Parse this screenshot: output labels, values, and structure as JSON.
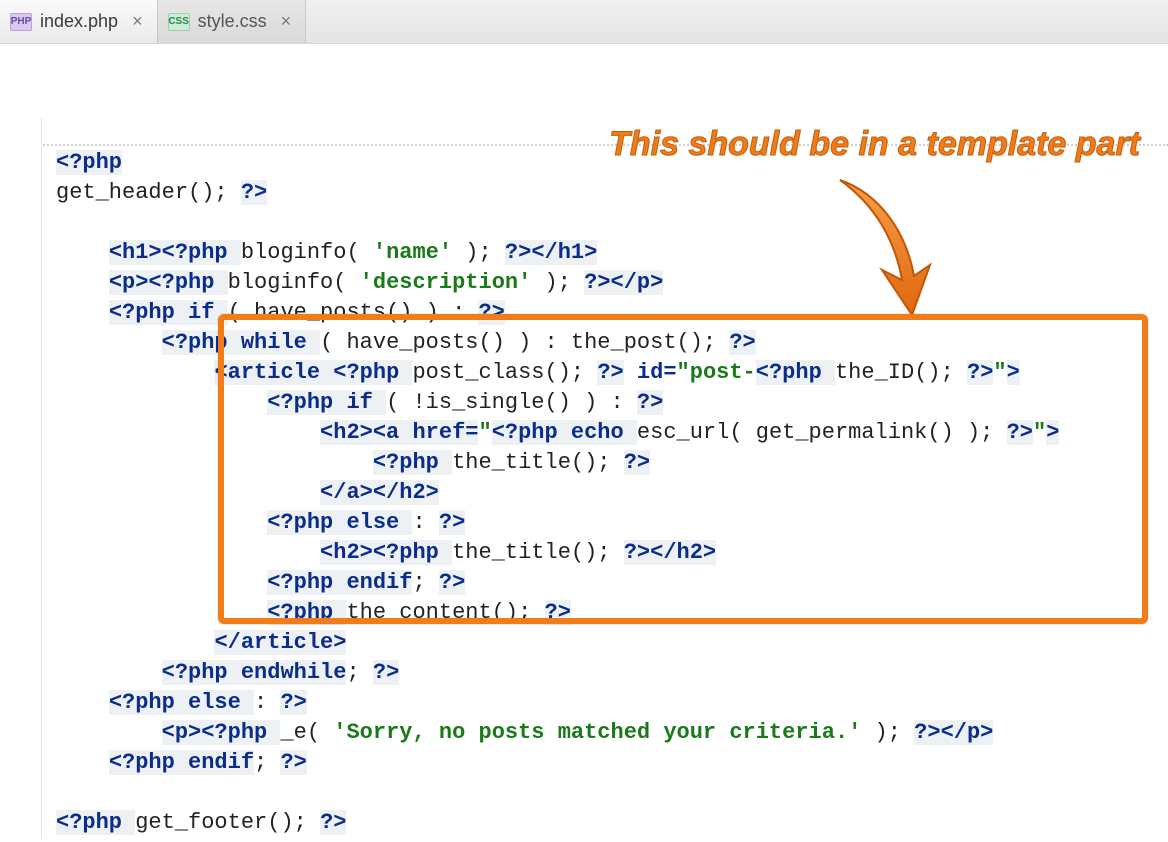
{
  "tabs": [
    {
      "label": "index.php",
      "icon": "PHP",
      "active": true
    },
    {
      "label": "style.css",
      "icon": "CSS",
      "active": false
    }
  ],
  "callout": "This should be in a template part",
  "code": {
    "l1a": "<?php",
    "l2a": "get_header(); ",
    "l2b": "?>",
    "l4_h1o": "<h1>",
    "l4_php1": "<?php ",
    "l4_fn": "bloginfo( ",
    "l4_str": "'name'",
    "l4_fn2": " ); ",
    "l4_php2": "?>",
    "l4_h1c": "</h1>",
    "l5_po": "<p>",
    "l5_php1": "<?php ",
    "l5_fn": "bloginfo( ",
    "l5_str": "'description'",
    "l5_fn2": " ); ",
    "l5_php2": "?>",
    "l5_pc": "</p>",
    "l6_php1": "<?php ",
    "l6_if": "if ",
    "l6_cond": "( have_posts() ) : ",
    "l6_php2": "?>",
    "l7_php1": "<?php ",
    "l7_while": "while ",
    "l7_cond": "( have_posts() ) : the_post(); ",
    "l7_php2": "?>",
    "l8_art": "<article ",
    "l8_php1": "<?php ",
    "l8_fn": "post_class(); ",
    "l8_php2": "?>",
    "l8_id": " id=",
    "l8_q1": "\"",
    "l8_post": "post-",
    "l8_php3": "<?php ",
    "l8_fn2": "the_ID(); ",
    "l8_php4": "?>",
    "l8_q2": "\"",
    "l8_gt": ">",
    "l9_php1": "<?php ",
    "l9_if": "if ",
    "l9_cond": "( !is_single() ) : ",
    "l9_php2": "?>",
    "l10_h2o": "<h2>",
    "l10_ao": "<a ",
    "l10_href": "href=",
    "l10_q1": "\"",
    "l10_php1": "<?php ",
    "l10_echo": "echo ",
    "l10_fn": "esc_url( get_permalink() ); ",
    "l10_php2": "?>",
    "l10_q2": "\"",
    "l10_gt": ">",
    "l11_php1": "<?php ",
    "l11_fn": "the_title(); ",
    "l11_php2": "?>",
    "l12_ac": "</a>",
    "l12_h2c": "</h2>",
    "l13_php1": "<?php ",
    "l13_else": "else ",
    "l13_colon": ": ",
    "l13_php2": "?>",
    "l14_h2o": "<h2>",
    "l14_php1": "<?php ",
    "l14_fn": "the_title(); ",
    "l14_php2": "?>",
    "l14_h2c": "</h2>",
    "l15_php1": "<?php ",
    "l15_endif": "endif",
    "l15_semi": "; ",
    "l15_php2": "?>",
    "l16_php1": "<?php ",
    "l16_fn": "the_content(); ",
    "l16_php2": "?>",
    "l17_artc": "</article>",
    "l18_php1": "<?php ",
    "l18_endwhile": "endwhile",
    "l18_semi": "; ",
    "l18_php2": "?>",
    "l19_php1": "<?php ",
    "l19_else": "else ",
    "l19_colon": ": ",
    "l19_php2": "?>",
    "l20_po": "<p>",
    "l20_php1": "<?php ",
    "l20_fn": "_e( ",
    "l20_str": "'Sorry, no posts matched your criteria.'",
    "l20_fn2": " ); ",
    "l20_php2": "?>",
    "l20_pc": "</p>",
    "l21_php1": "<?php ",
    "l21_endif": "endif",
    "l21_semi": "; ",
    "l21_php2": "?>",
    "l23_php1": "<?php ",
    "l23_fn": "get_footer(); ",
    "l23_php2": "?>"
  }
}
